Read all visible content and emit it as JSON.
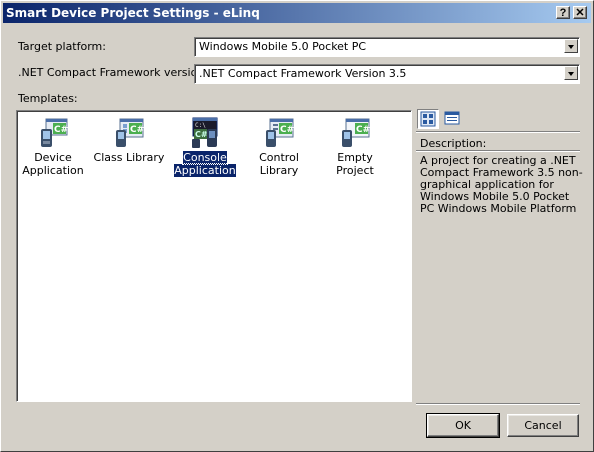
{
  "window": {
    "title": "Smart Device Project Settings - eLinq",
    "help_glyph": "?",
    "close_glyph": "✕"
  },
  "target_platform": {
    "label": "Target platform:",
    "value": "Windows Mobile 5.0 Pocket PC"
  },
  "framework_version": {
    "label": ".NET Compact Framework version:",
    "value": ".NET Compact Framework Version 3.5"
  },
  "templates": {
    "label": "Templates:",
    "items": [
      {
        "line1": "Device",
        "line2": "Application",
        "icon": "device-application-icon",
        "selected": false
      },
      {
        "line1": "Class Library",
        "line2": "",
        "icon": "class-library-icon",
        "selected": false
      },
      {
        "line1": "Console",
        "line2": "Application",
        "icon": "console-application-icon",
        "selected": true
      },
      {
        "line1": "Control Library",
        "line2": "",
        "icon": "control-library-icon",
        "selected": false
      },
      {
        "line1": "Empty Project",
        "line2": "",
        "icon": "empty-project-icon",
        "selected": false
      }
    ]
  },
  "view_buttons": {
    "large_icons": "large-icons-view-icon",
    "small_icons": "small-icons-view-icon"
  },
  "description": {
    "label": "Description:",
    "text": "A project for creating a .NET Compact Framework 3.5 non-graphical application for Windows Mobile 5.0 Pocket PC Windows Mobile Platform"
  },
  "buttons": {
    "ok": "OK",
    "cancel": "Cancel"
  },
  "colors": {
    "title_gradient_start": "#0a246a",
    "title_gradient_end": "#a6caf0",
    "dialog_face": "#d4d0c8",
    "selection": "#0a246a",
    "csharp_green": "#4caf50"
  }
}
